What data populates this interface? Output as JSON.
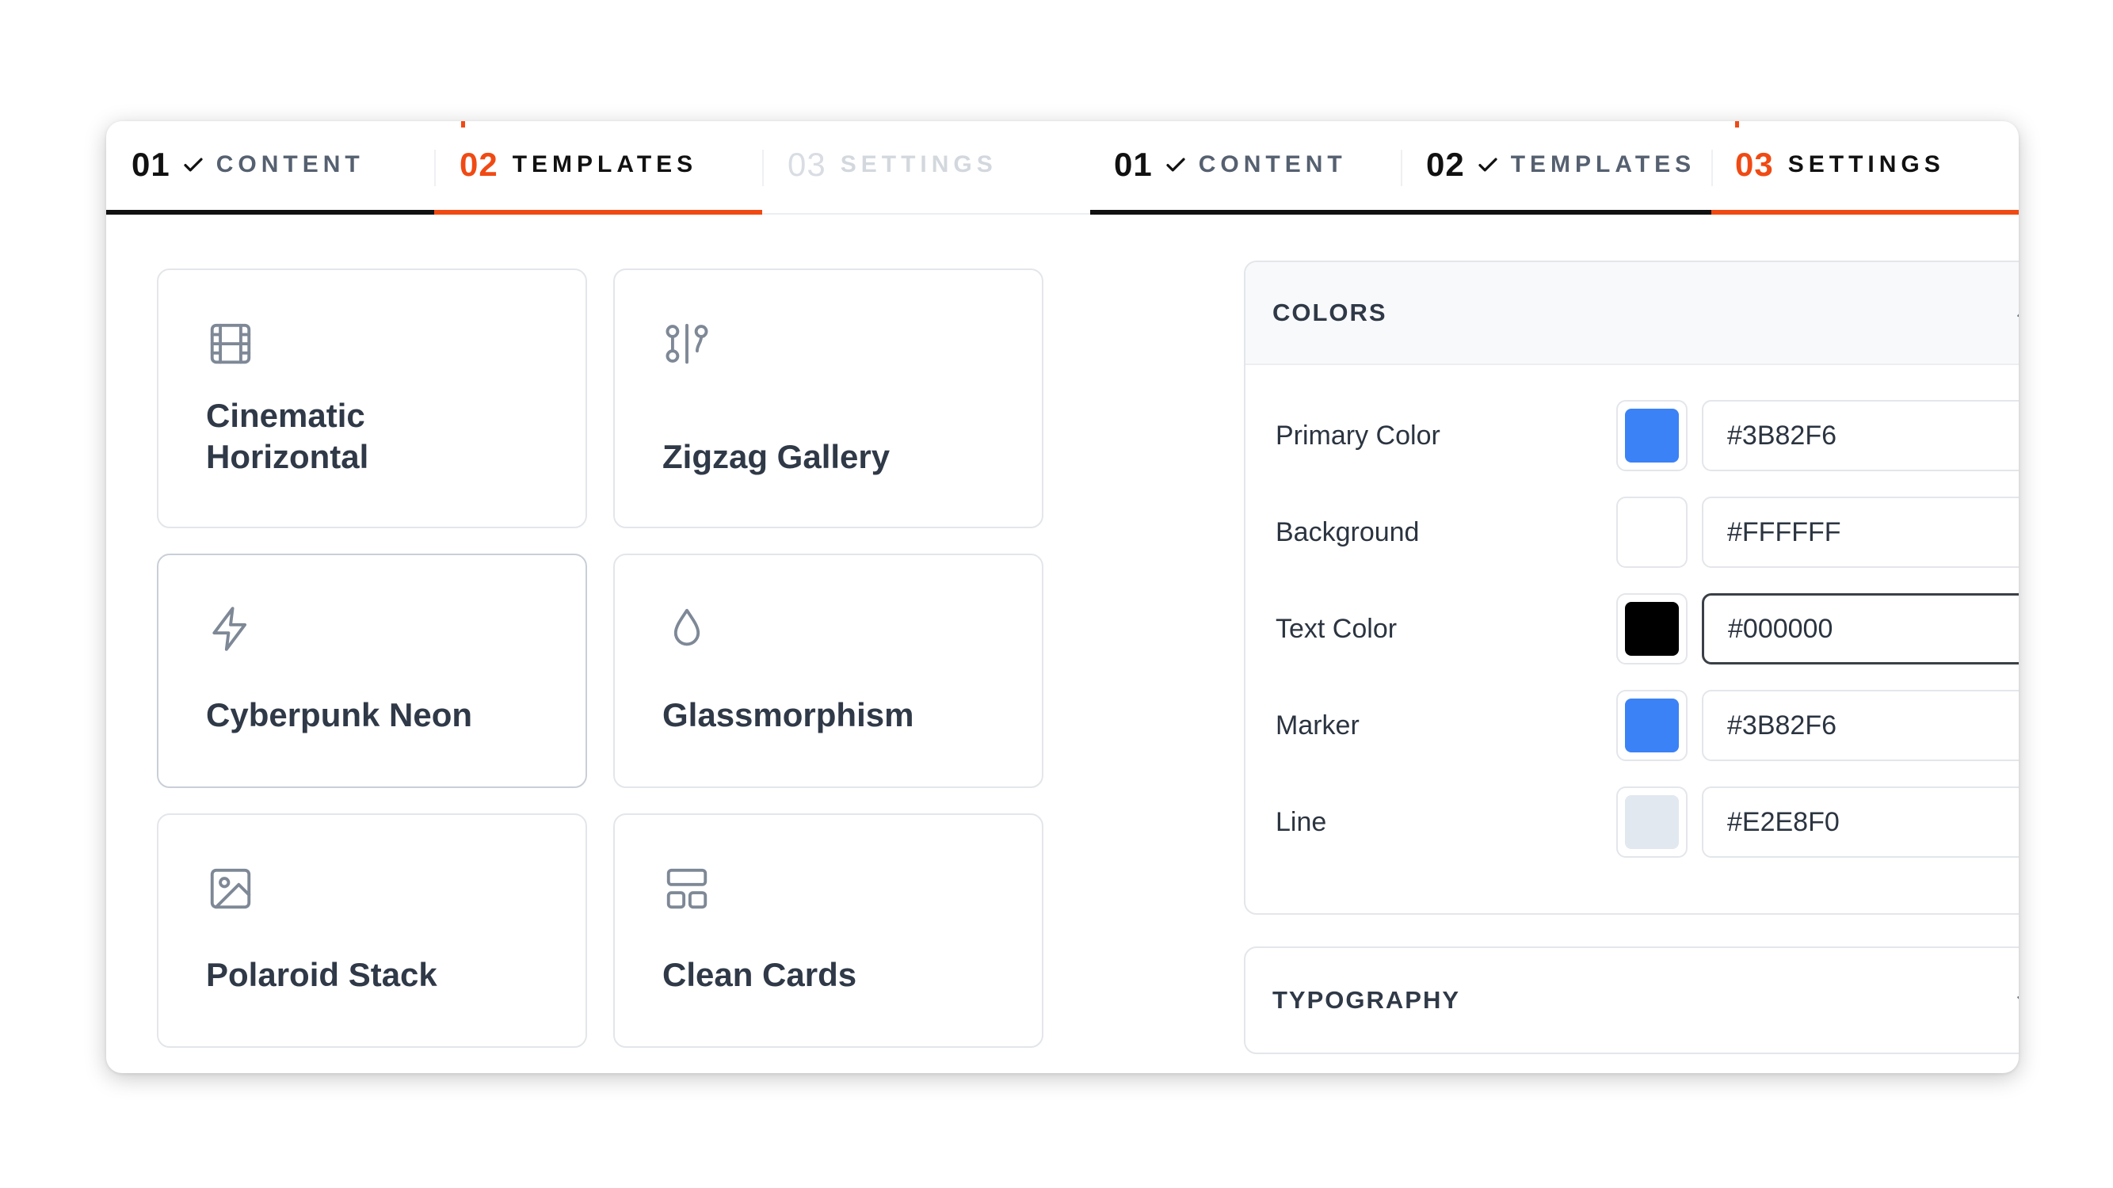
{
  "left_steps": [
    {
      "num": "01",
      "label": "CONTENT",
      "state": "done"
    },
    {
      "num": "02",
      "label": "TEMPLATES",
      "state": "active"
    },
    {
      "num": "03",
      "label": "SETTINGS",
      "state": "todo"
    }
  ],
  "right_steps": [
    {
      "num": "01",
      "label": "CONTENT",
      "state": "done"
    },
    {
      "num": "02",
      "label": "TEMPLATES",
      "state": "done"
    },
    {
      "num": "03",
      "label": "SETTINGS",
      "state": "active"
    }
  ],
  "templates": [
    {
      "title_line1": "Cinematic",
      "title_line2": "Horizontal",
      "icon": "film-icon"
    },
    {
      "title": "Zigzag Gallery",
      "icon": "zigzag-path-icon"
    },
    {
      "title": "Cyberpunk Neon",
      "icon": "lightning-bolt-icon"
    },
    {
      "title": "Glassmorphism",
      "icon": "droplet-icon"
    },
    {
      "title": "Polaroid Stack",
      "icon": "image-icon"
    },
    {
      "title": "Clean Cards",
      "icon": "layout-cards-icon"
    }
  ],
  "settings": {
    "colors_section": {
      "title": "COLORS",
      "expanded": true,
      "rows": [
        {
          "label": "Primary Color",
          "value": "#3B82F6",
          "swatch": "#3B82F6"
        },
        {
          "label": "Background",
          "value": "#FFFFFF",
          "swatch": "#FFFFFF"
        },
        {
          "label": "Text Color",
          "value": "#000000",
          "swatch": "#000000"
        },
        {
          "label": "Marker",
          "value": "#3B82F6",
          "swatch": "#3B82F6"
        },
        {
          "label": "Line",
          "value": "#E2E8F0",
          "swatch": "#E2E8F0"
        }
      ]
    },
    "typography_section": {
      "title": "TYPOGRAPHY",
      "expanded": false
    }
  },
  "theme": {
    "accent": "#F04A14",
    "text_dark": "#111111",
    "muted": "#556070"
  }
}
